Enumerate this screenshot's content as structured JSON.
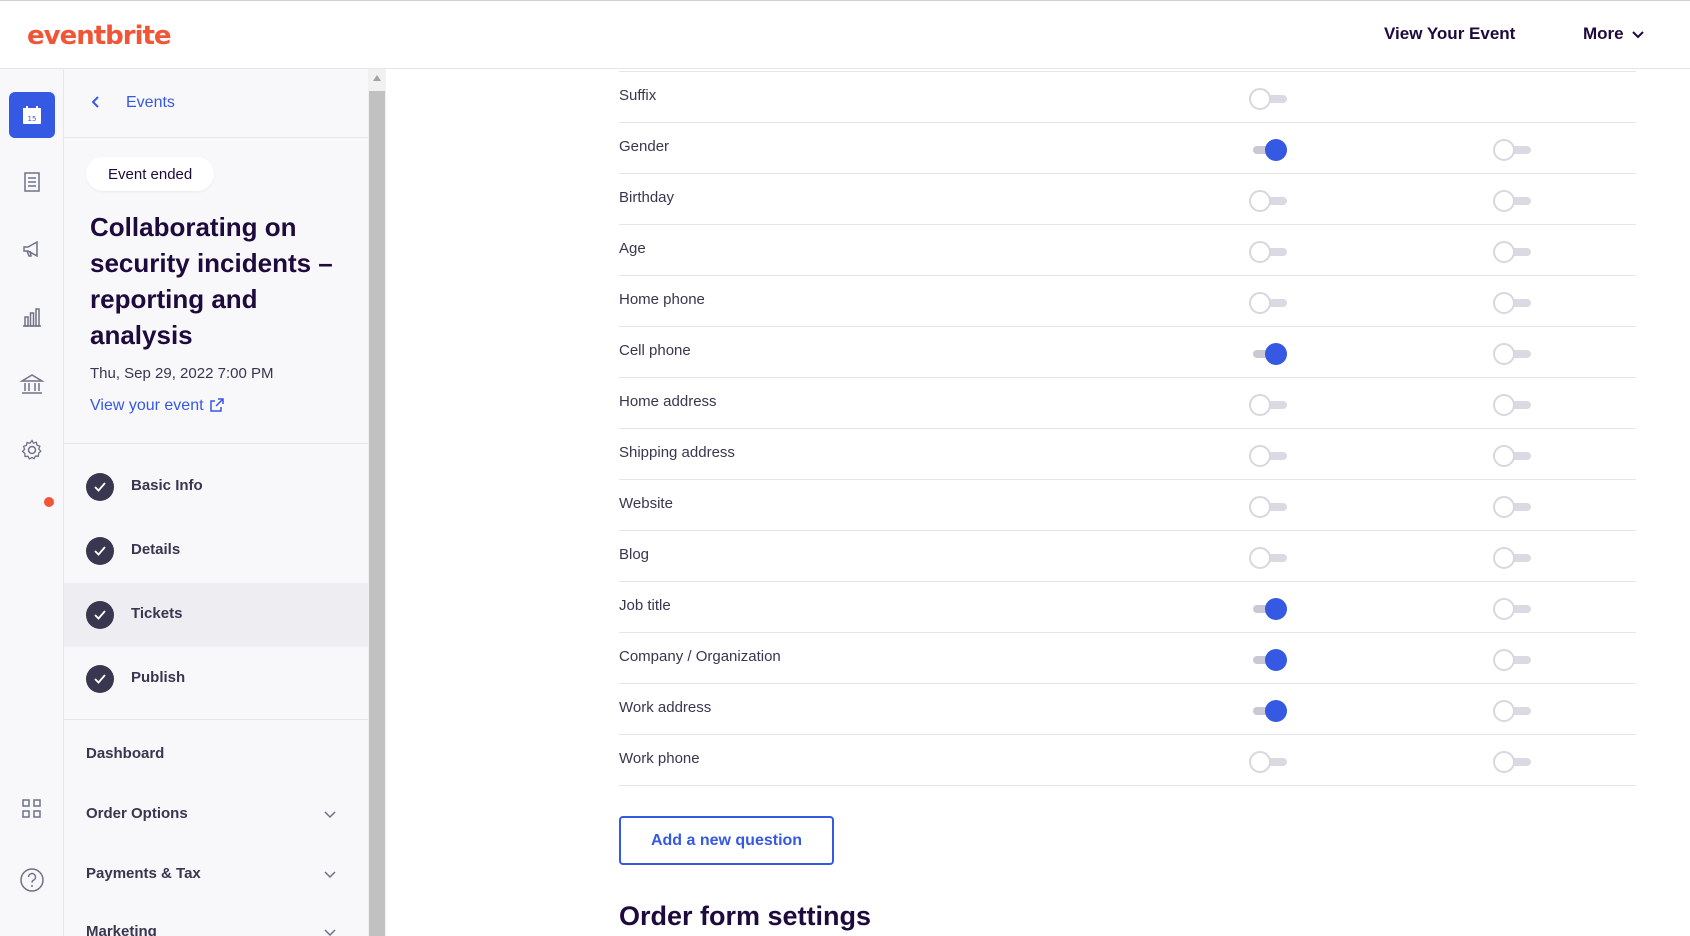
{
  "header": {
    "logo": "eventbrite",
    "view_event": "View Your Event",
    "more": "More"
  },
  "rail": {
    "icons": [
      "calendar-icon",
      "orders-icon",
      "megaphone-icon",
      "reports-icon",
      "finance-icon",
      "settings-icon",
      "apps-icon",
      "help-icon"
    ],
    "calendar_day": "15",
    "accent": "#3659e3"
  },
  "sidebar": {
    "back_label": "Events",
    "status_badge": "Event ended",
    "event_title": "Collaborating on security incidents – reporting and analysis",
    "event_date": "Thu, Sep 29, 2022 7:00 PM",
    "view_link": "View your event",
    "steps": [
      {
        "label": "Basic Info",
        "done": true
      },
      {
        "label": "Details",
        "done": true
      },
      {
        "label": "Tickets",
        "done": true,
        "active": true
      },
      {
        "label": "Publish",
        "done": true
      }
    ],
    "nav": [
      {
        "label": "Dashboard"
      },
      {
        "label": "Order Options"
      },
      {
        "label": "Payments & Tax"
      },
      {
        "label": "Marketing"
      }
    ]
  },
  "questions": [
    {
      "label": "Suffix",
      "include": false
    },
    {
      "label": "Gender",
      "include": true,
      "require": false
    },
    {
      "label": "Birthday",
      "include": false,
      "require": false
    },
    {
      "label": "Age",
      "include": false,
      "require": false
    },
    {
      "label": "Home phone",
      "include": false,
      "require": false
    },
    {
      "label": "Cell phone",
      "include": true,
      "require": false
    },
    {
      "label": "Home address",
      "include": false,
      "require": false
    },
    {
      "label": "Shipping address",
      "include": false,
      "require": false
    },
    {
      "label": "Website",
      "include": false,
      "require": false
    },
    {
      "label": "Blog",
      "include": false,
      "require": false
    },
    {
      "label": "Job title",
      "include": true,
      "require": false
    },
    {
      "label": "Company / Organization",
      "include": true,
      "require": false
    },
    {
      "label": "Work address",
      "include": true,
      "require": false
    },
    {
      "label": "Work phone",
      "include": false,
      "require": false
    }
  ],
  "main": {
    "add_question": "Add a new question",
    "section_heading": "Order form settings"
  }
}
